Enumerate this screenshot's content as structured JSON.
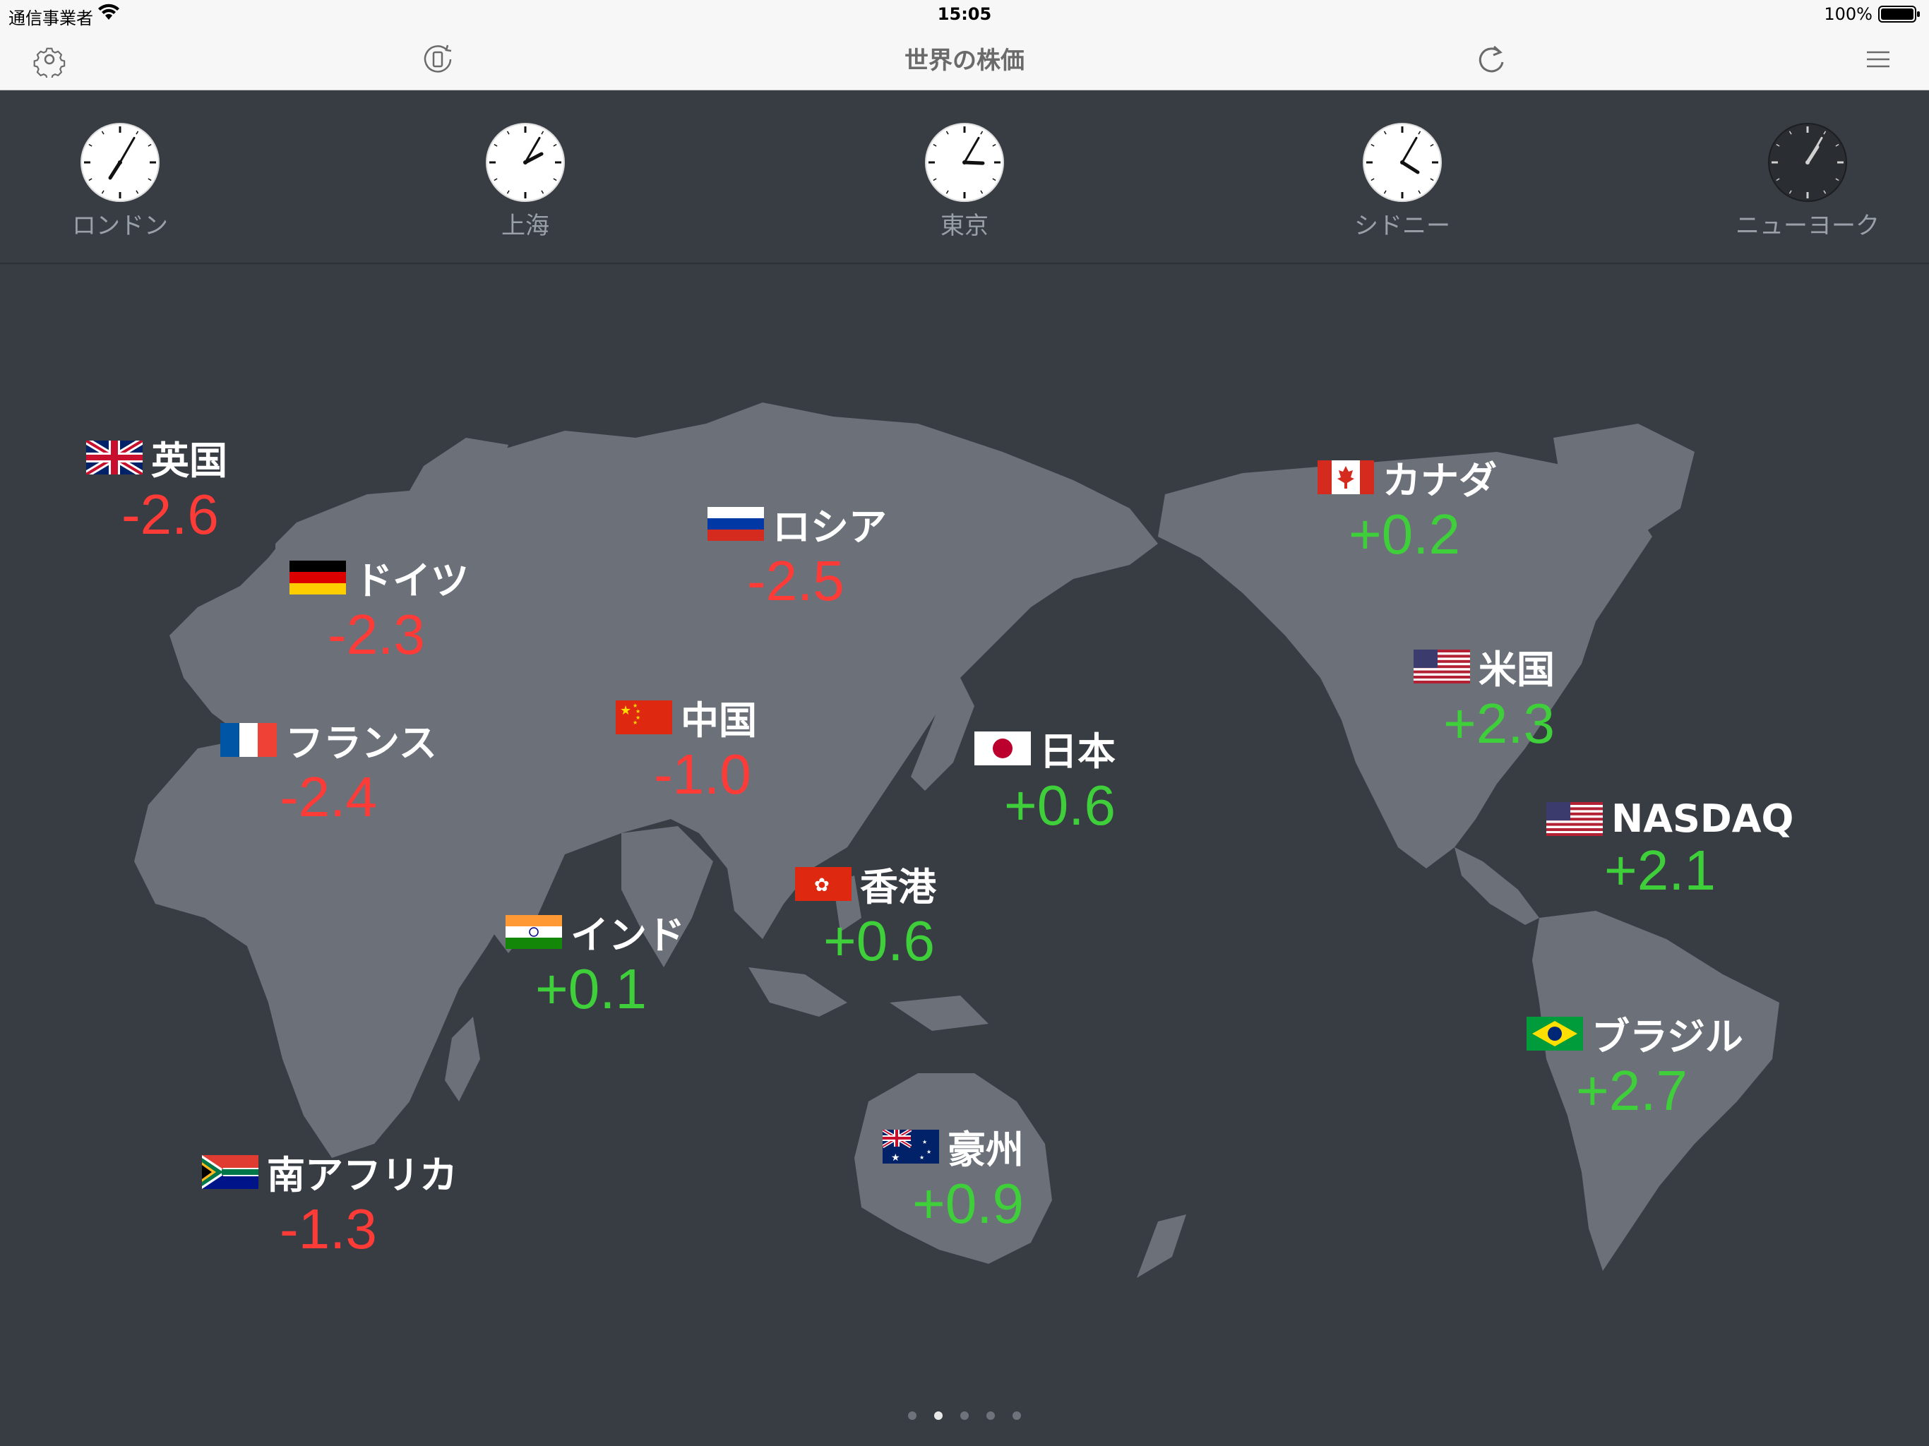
{
  "status_bar": {
    "carrier": "通信事業者",
    "time": "15:05",
    "battery": "100%"
  },
  "nav": {
    "title": "世界の株価"
  },
  "clocks": [
    {
      "name": "ロンドン",
      "hour": 7.08,
      "minute": 5,
      "dark": false
    },
    {
      "name": "上海",
      "hour": 2.08,
      "minute": 5,
      "dark": false
    },
    {
      "name": "東京",
      "hour": 3.08,
      "minute": 5,
      "dark": false
    },
    {
      "name": "シドニー",
      "hour": 4.08,
      "minute": 5,
      "dark": false
    },
    {
      "name": "ニューヨーク",
      "hour": 1.08,
      "minute": 5,
      "dark": true
    }
  ],
  "markets": [
    {
      "id": "uk",
      "name": "英国",
      "value": "-2.6",
      "sign": "neg",
      "flag": "uk-flag"
    },
    {
      "id": "germany",
      "name": "ドイツ",
      "value": "-2.3",
      "sign": "neg",
      "flag": "germany-flag"
    },
    {
      "id": "russia",
      "name": "ロシア",
      "value": "-2.5",
      "sign": "neg",
      "flag": "russia-flag"
    },
    {
      "id": "france",
      "name": "フランス",
      "value": "-2.4",
      "sign": "neg",
      "flag": "france-flag"
    },
    {
      "id": "china",
      "name": "中国",
      "value": "-1.0",
      "sign": "neg",
      "flag": "china-flag"
    },
    {
      "id": "japan",
      "name": "日本",
      "value": "+0.6",
      "sign": "pos",
      "flag": "japan-flag"
    },
    {
      "id": "hongkong",
      "name": "香港",
      "value": "+0.6",
      "sign": "pos",
      "flag": "hongkong-flag"
    },
    {
      "id": "india",
      "name": "インド",
      "value": "+0.1",
      "sign": "pos",
      "flag": "india-flag"
    },
    {
      "id": "southafrica",
      "name": "南アフリカ",
      "value": "-1.3",
      "sign": "neg",
      "flag": "southafrica-flag"
    },
    {
      "id": "australia",
      "name": "豪州",
      "value": "+0.9",
      "sign": "pos",
      "flag": "australia-flag"
    },
    {
      "id": "canada",
      "name": "カナダ",
      "value": "+0.2",
      "sign": "pos",
      "flag": "canada-flag"
    },
    {
      "id": "usa",
      "name": "米国",
      "value": "+2.3",
      "sign": "pos",
      "flag": "usa-flag"
    },
    {
      "id": "nasdaq",
      "name": "NASDAQ",
      "value": "+2.1",
      "sign": "pos",
      "flag": "usa-flag"
    },
    {
      "id": "brazil",
      "name": "ブラジル",
      "value": "+2.7",
      "sign": "pos",
      "flag": "brazil-flag"
    }
  ],
  "colors": {
    "negative": "#ff3b38",
    "positive": "#3ecf3a",
    "background": "#383d44",
    "land": "#6b7079"
  },
  "pager": {
    "count": 5,
    "active": 1
  }
}
